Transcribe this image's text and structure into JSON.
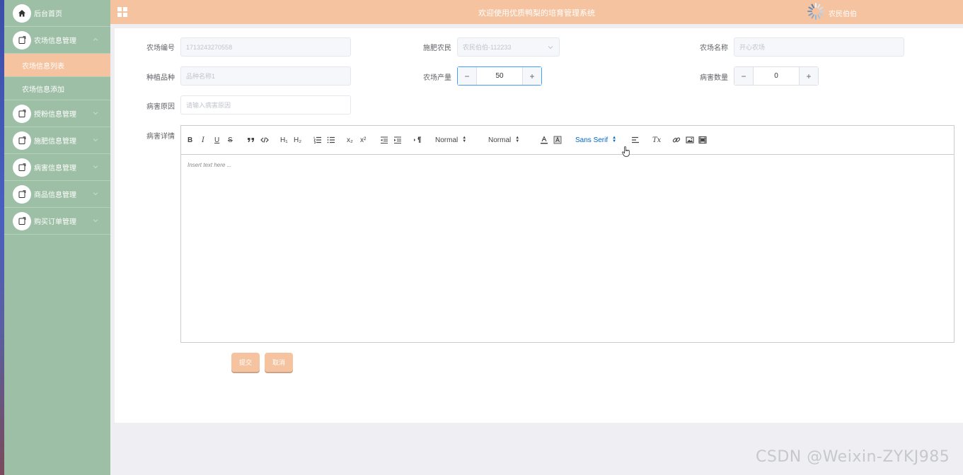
{
  "header": {
    "title": "欢迎使用优质鸭梨的培育管理系统",
    "user_name": "农民伯伯"
  },
  "sidebar": {
    "items": [
      {
        "label": "后台首页",
        "icon": "home-icon"
      },
      {
        "label": "农场信息管理",
        "icon": "document-icon",
        "expanded": true,
        "children": [
          {
            "label": "农场信息列表",
            "active": true
          },
          {
            "label": "农场信息添加",
            "active": false
          }
        ]
      },
      {
        "label": "授粉信息管理",
        "icon": "document-icon"
      },
      {
        "label": "施肥信息管理",
        "icon": "document-icon"
      },
      {
        "label": "病害信息管理",
        "icon": "document-icon"
      },
      {
        "label": "商品信息管理",
        "icon": "document-icon"
      },
      {
        "label": "购买订单管理",
        "icon": "document-icon"
      }
    ]
  },
  "form": {
    "farm_no": {
      "label": "农场编号",
      "value": "1713243270558"
    },
    "farmer": {
      "label": "施肥农民",
      "value": "农民伯伯-112233"
    },
    "farm_name": {
      "label": "农场名称",
      "placeholder": "开心农场"
    },
    "variety": {
      "label": "种植品种",
      "placeholder": "品种名称1"
    },
    "yield": {
      "label": "农场产量",
      "value": "50"
    },
    "disease_count": {
      "label": "病害数量",
      "value": "0"
    },
    "disease_cause": {
      "label": "病害原因",
      "placeholder": "请输入病害原因"
    },
    "disease_detail": {
      "label": "病害详情",
      "placeholder": "Insert text here ..."
    }
  },
  "toolbar": {
    "bold": "B",
    "italic": "I",
    "underline": "U",
    "strike": "S",
    "header1": "H₁",
    "header2": "H₂",
    "subscript": "x₂",
    "superscript": "x²",
    "size_picker": "Normal",
    "header_picker": "Normal",
    "font_picker": "Sans Serif",
    "clean": "Tx"
  },
  "actions": {
    "submit": "提交",
    "cancel": "取消"
  },
  "watermark": "CSDN @Weixin-ZYKJ985",
  "colors": {
    "sidebar_bg": "#9dbfa6",
    "accent": "#f5c39f",
    "focus": "#409eff"
  }
}
